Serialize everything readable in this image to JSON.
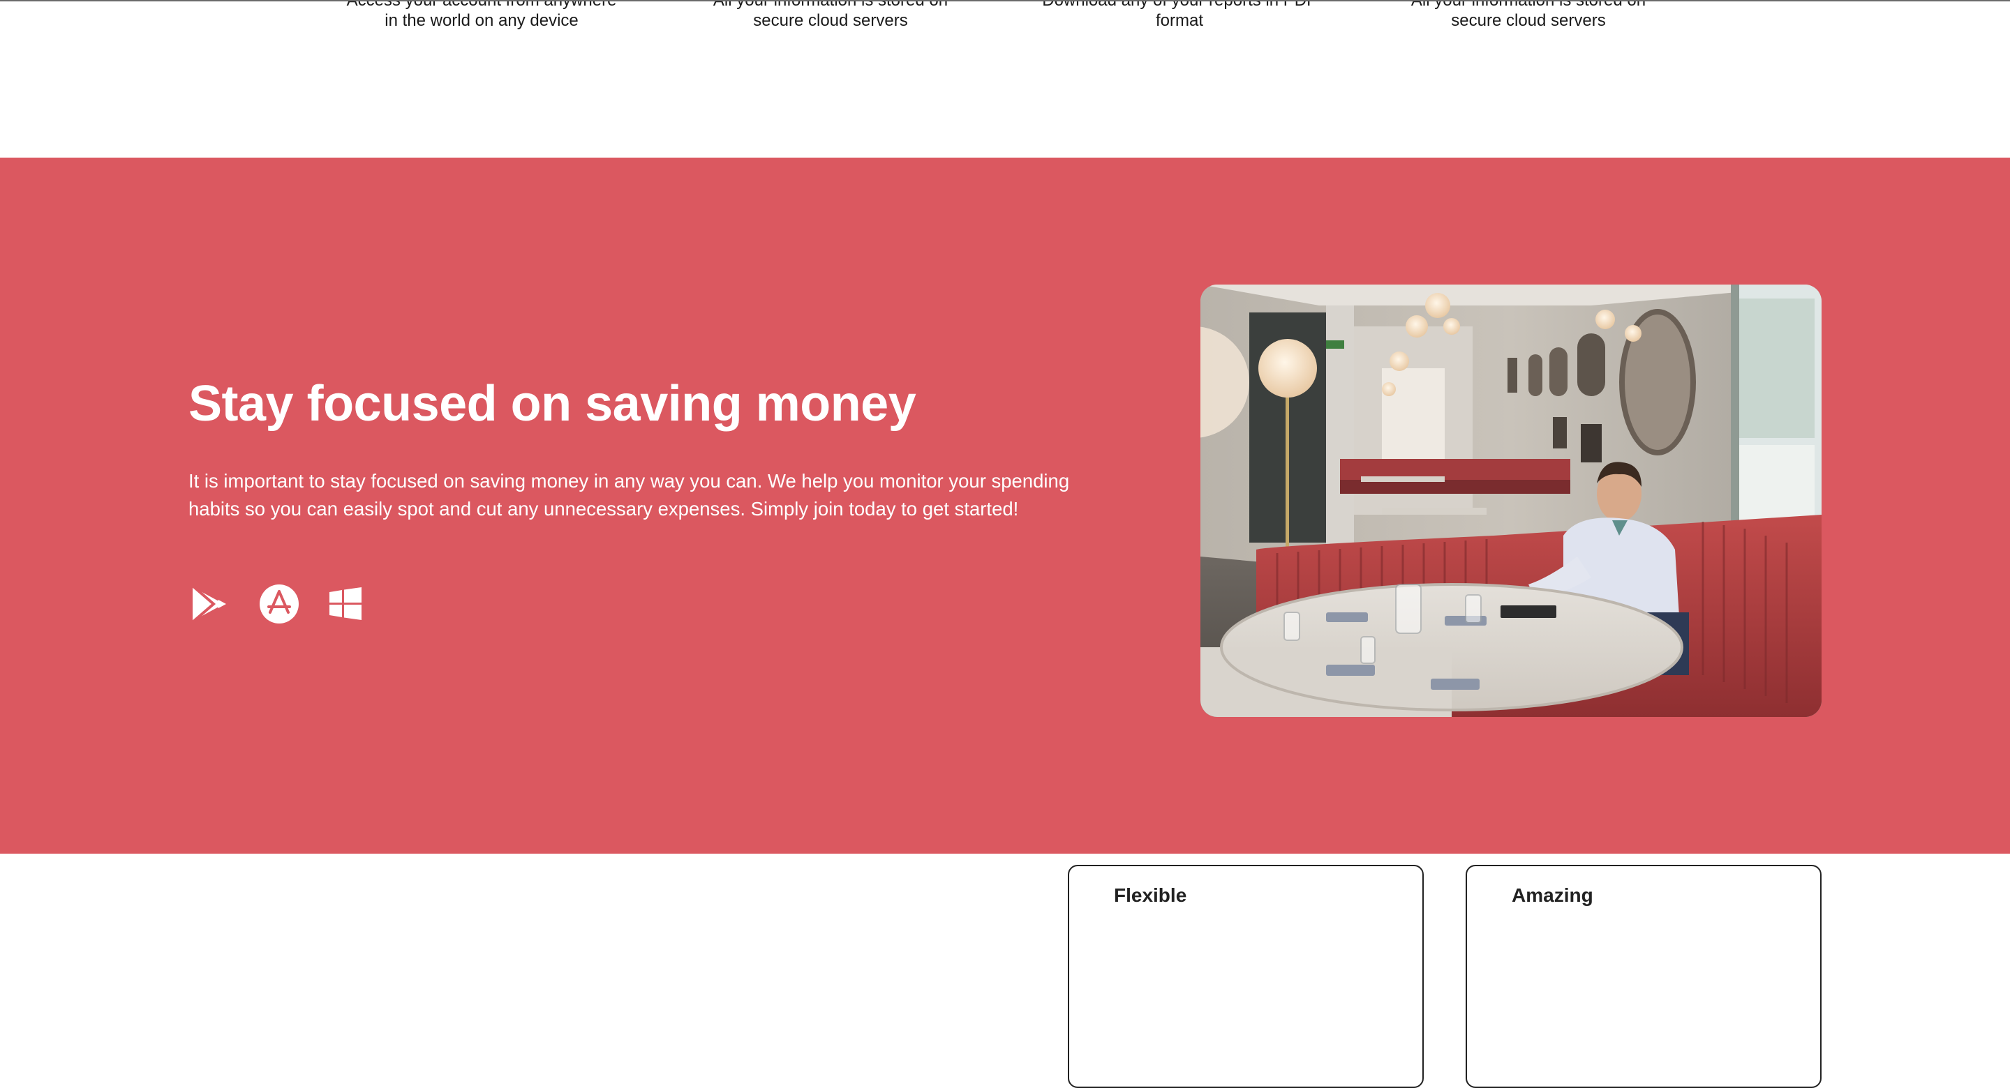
{
  "features": [
    {
      "line1": "Access your account from anywhere",
      "line2": "in the world on any device"
    },
    {
      "line1": "All your information is stored on",
      "line2": "secure cloud servers"
    },
    {
      "line1": "Download any of your reports in PDF",
      "line2": "format"
    },
    {
      "line1": "All your information is stored on",
      "line2": "secure cloud servers"
    }
  ],
  "promo": {
    "title": "Stay focused on saving money",
    "body": "It is important to stay focused on saving money in any way you can. We help you monitor your spending habits so you can easily spot and cut any unnecessary expenses. Simply join today to get started!",
    "icons": [
      "google-play-icon",
      "app-store-icon",
      "windows-icon"
    ],
    "background": "#db5860",
    "text_color": "#ffffff"
  },
  "cards": [
    {
      "label": "Flexible"
    },
    {
      "label": "Amazing"
    }
  ]
}
